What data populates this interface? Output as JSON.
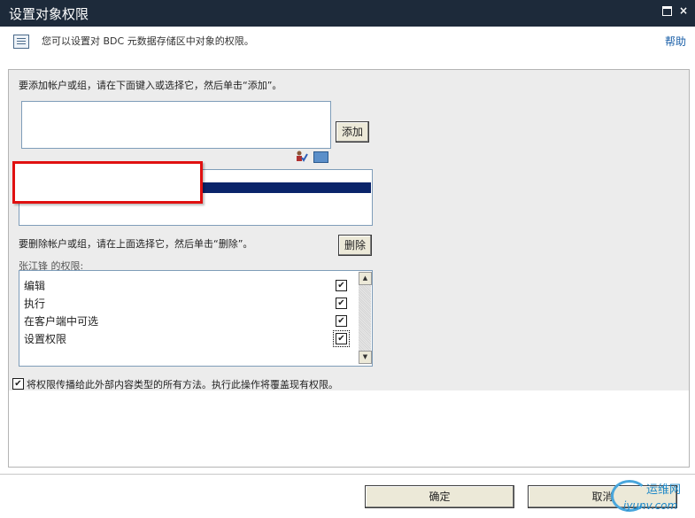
{
  "window": {
    "title": "设置对象权限"
  },
  "header": {
    "description": "您可以设置对 BDC 元数据存储区中对象的权限。",
    "help_link": "帮助"
  },
  "add_section": {
    "instruction": "要添加帐户或组，请在下面键入或选择它，然后单击“添加”。",
    "input_value": "",
    "add_button": "添加",
    "icons": [
      "check-names-icon",
      "browse-directory-icon"
    ]
  },
  "delete_section": {
    "instruction": "要删除帐户或组，请在上面选择它，然后单击“删除”。",
    "delete_button": "删除"
  },
  "permissions": {
    "label": "张江锋 的权限:",
    "items": [
      {
        "label": "编辑",
        "checked": true
      },
      {
        "label": "执行",
        "checked": true
      },
      {
        "label": "在客户端中可选",
        "checked": true
      },
      {
        "label": "设置权限",
        "checked": true
      }
    ]
  },
  "propagate": {
    "label": "将权限传播给此外部内容类型的所有方法。执行此操作将覆盖现有权限。",
    "checked": true
  },
  "footer": {
    "ok_button": "确定",
    "cancel_button": "取消"
  },
  "watermark": {
    "line1": "运维网",
    "line2": "iyunv.com"
  },
  "colors": {
    "titlebar": "#1d2a3a",
    "selection": "#0a246a",
    "highlight_border": "#e01010",
    "link": "#1a5fa8"
  }
}
